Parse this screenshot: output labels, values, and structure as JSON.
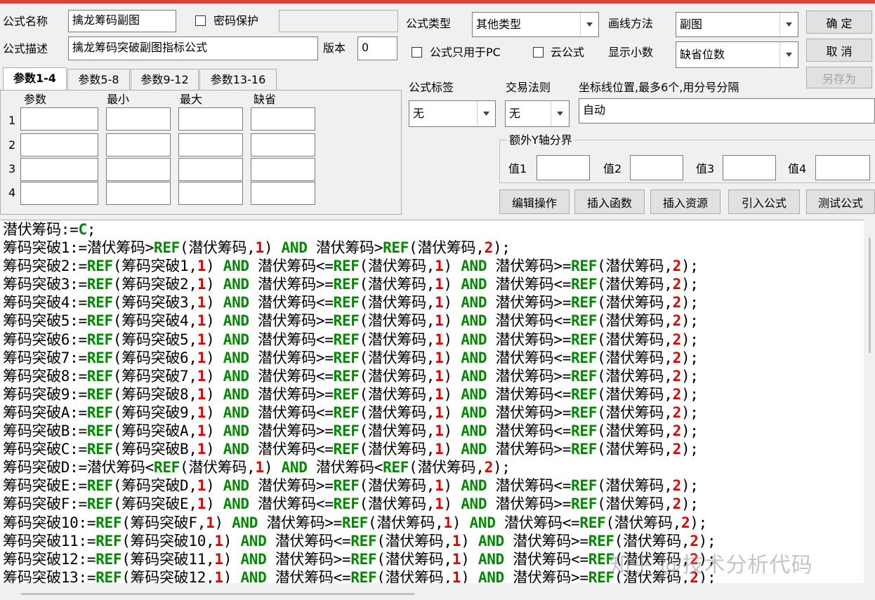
{
  "form": {
    "name_label": "公式名称",
    "name_value": "擒龙筹码副图",
    "password_label": "密码保护",
    "desc_label": "公式描述",
    "desc_value": "擒龙筹码突破副图指标公式",
    "version_label": "版本",
    "version_value": "0",
    "type_label": "公式类型",
    "type_value": "其他类型",
    "draw_label": "画线方法",
    "draw_value": "副图",
    "pc_only_label": "公式只用于PC",
    "cloud_label": "云公式",
    "decimal_label": "显示小数",
    "decimal_value": "缺省位数",
    "tag_label": "公式标签",
    "tag_value": "无",
    "trade_label": "交易法则",
    "trade_value": "无",
    "axis_label": "坐标线位置,最多6个,用分号分隔",
    "axis_value": "自动",
    "extra_y_label": "额外Y轴分界",
    "v1_label": "值1",
    "v2_label": "值2",
    "v3_label": "值3",
    "v4_label": "值4"
  },
  "buttons": {
    "ok": "确 定",
    "cancel": "取 消",
    "save_as": "另存为",
    "edit_ops": "编辑操作",
    "insert_func": "插入函数",
    "insert_res": "插入资源",
    "import_formula": "引入公式",
    "test_formula": "测试公式"
  },
  "tabs": [
    "参数1-4",
    "参数5-8",
    "参数9-12",
    "参数13-16"
  ],
  "param_headers": [
    "参数",
    "最小",
    "最大",
    "缺省"
  ],
  "param_rows": [
    "1",
    "2",
    "3",
    "4"
  ],
  "code_lines": [
    [
      [
        "t",
        "潜伏筹码:="
      ],
      [
        "k",
        "C"
      ],
      [
        "t",
        ";"
      ]
    ],
    [
      [
        "t",
        "筹码突破1:=潜伏筹码>"
      ],
      [
        "k",
        "REF"
      ],
      [
        "t",
        "(潜伏筹码,"
      ],
      [
        "n",
        "1"
      ],
      [
        "t",
        ") "
      ],
      [
        "k",
        "AND"
      ],
      [
        "t",
        " 潜伏筹码>"
      ],
      [
        "k",
        "REF"
      ],
      [
        "t",
        "(潜伏筹码,"
      ],
      [
        "n",
        "2"
      ],
      [
        "t",
        ");"
      ]
    ],
    [
      [
        "t",
        "筹码突破2:="
      ],
      [
        "k",
        "REF"
      ],
      [
        "t",
        "(筹码突破1,"
      ],
      [
        "n",
        "1"
      ],
      [
        "t",
        ") "
      ],
      [
        "k",
        "AND"
      ],
      [
        "t",
        " 潜伏筹码<="
      ],
      [
        "k",
        "REF"
      ],
      [
        "t",
        "(潜伏筹码,"
      ],
      [
        "n",
        "1"
      ],
      [
        "t",
        ") "
      ],
      [
        "k",
        "AND"
      ],
      [
        "t",
        " 潜伏筹码>="
      ],
      [
        "k",
        "REF"
      ],
      [
        "t",
        "(潜伏筹码,"
      ],
      [
        "n",
        "2"
      ],
      [
        "t",
        ");"
      ]
    ],
    [
      [
        "t",
        "筹码突破3:="
      ],
      [
        "k",
        "REF"
      ],
      [
        "t",
        "(筹码突破2,"
      ],
      [
        "n",
        "1"
      ],
      [
        "t",
        ") "
      ],
      [
        "k",
        "AND"
      ],
      [
        "t",
        " 潜伏筹码>="
      ],
      [
        "k",
        "REF"
      ],
      [
        "t",
        "(潜伏筹码,"
      ],
      [
        "n",
        "1"
      ],
      [
        "t",
        ") "
      ],
      [
        "k",
        "AND"
      ],
      [
        "t",
        " 潜伏筹码<="
      ],
      [
        "k",
        "REF"
      ],
      [
        "t",
        "(潜伏筹码,"
      ],
      [
        "n",
        "2"
      ],
      [
        "t",
        ");"
      ]
    ],
    [
      [
        "t",
        "筹码突破4:="
      ],
      [
        "k",
        "REF"
      ],
      [
        "t",
        "(筹码突破3,"
      ],
      [
        "n",
        "1"
      ],
      [
        "t",
        ") "
      ],
      [
        "k",
        "AND"
      ],
      [
        "t",
        " 潜伏筹码<="
      ],
      [
        "k",
        "REF"
      ],
      [
        "t",
        "(潜伏筹码,"
      ],
      [
        "n",
        "1"
      ],
      [
        "t",
        ") "
      ],
      [
        "k",
        "AND"
      ],
      [
        "t",
        " 潜伏筹码>="
      ],
      [
        "k",
        "REF"
      ],
      [
        "t",
        "(潜伏筹码,"
      ],
      [
        "n",
        "2"
      ],
      [
        "t",
        ");"
      ]
    ],
    [
      [
        "t",
        "筹码突破5:="
      ],
      [
        "k",
        "REF"
      ],
      [
        "t",
        "(筹码突破4,"
      ],
      [
        "n",
        "1"
      ],
      [
        "t",
        ") "
      ],
      [
        "k",
        "AND"
      ],
      [
        "t",
        " 潜伏筹码>="
      ],
      [
        "k",
        "REF"
      ],
      [
        "t",
        "(潜伏筹码,"
      ],
      [
        "n",
        "1"
      ],
      [
        "t",
        ") "
      ],
      [
        "k",
        "AND"
      ],
      [
        "t",
        " 潜伏筹码<="
      ],
      [
        "k",
        "REF"
      ],
      [
        "t",
        "(潜伏筹码,"
      ],
      [
        "n",
        "2"
      ],
      [
        "t",
        ");"
      ]
    ],
    [
      [
        "t",
        "筹码突破6:="
      ],
      [
        "k",
        "REF"
      ],
      [
        "t",
        "(筹码突破5,"
      ],
      [
        "n",
        "1"
      ],
      [
        "t",
        ") "
      ],
      [
        "k",
        "AND"
      ],
      [
        "t",
        " 潜伏筹码<="
      ],
      [
        "k",
        "REF"
      ],
      [
        "t",
        "(潜伏筹码,"
      ],
      [
        "n",
        "1"
      ],
      [
        "t",
        ") "
      ],
      [
        "k",
        "AND"
      ],
      [
        "t",
        " 潜伏筹码>="
      ],
      [
        "k",
        "REF"
      ],
      [
        "t",
        "(潜伏筹码,"
      ],
      [
        "n",
        "2"
      ],
      [
        "t",
        ");"
      ]
    ],
    [
      [
        "t",
        "筹码突破7:="
      ],
      [
        "k",
        "REF"
      ],
      [
        "t",
        "(筹码突破6,"
      ],
      [
        "n",
        "1"
      ],
      [
        "t",
        ") "
      ],
      [
        "k",
        "AND"
      ],
      [
        "t",
        " 潜伏筹码>="
      ],
      [
        "k",
        "REF"
      ],
      [
        "t",
        "(潜伏筹码,"
      ],
      [
        "n",
        "1"
      ],
      [
        "t",
        ") "
      ],
      [
        "k",
        "AND"
      ],
      [
        "t",
        " 潜伏筹码<="
      ],
      [
        "k",
        "REF"
      ],
      [
        "t",
        "(潜伏筹码,"
      ],
      [
        "n",
        "2"
      ],
      [
        "t",
        ");"
      ]
    ],
    [
      [
        "t",
        "筹码突破8:="
      ],
      [
        "k",
        "REF"
      ],
      [
        "t",
        "(筹码突破7,"
      ],
      [
        "n",
        "1"
      ],
      [
        "t",
        ") "
      ],
      [
        "k",
        "AND"
      ],
      [
        "t",
        " 潜伏筹码<="
      ],
      [
        "k",
        "REF"
      ],
      [
        "t",
        "(潜伏筹码,"
      ],
      [
        "n",
        "1"
      ],
      [
        "t",
        ") "
      ],
      [
        "k",
        "AND"
      ],
      [
        "t",
        " 潜伏筹码>="
      ],
      [
        "k",
        "REF"
      ],
      [
        "t",
        "(潜伏筹码,"
      ],
      [
        "n",
        "2"
      ],
      [
        "t",
        ");"
      ]
    ],
    [
      [
        "t",
        "筹码突破9:="
      ],
      [
        "k",
        "REF"
      ],
      [
        "t",
        "(筹码突破8,"
      ],
      [
        "n",
        "1"
      ],
      [
        "t",
        ") "
      ],
      [
        "k",
        "AND"
      ],
      [
        "t",
        " 潜伏筹码>="
      ],
      [
        "k",
        "REF"
      ],
      [
        "t",
        "(潜伏筹码,"
      ],
      [
        "n",
        "1"
      ],
      [
        "t",
        ") "
      ],
      [
        "k",
        "AND"
      ],
      [
        "t",
        " 潜伏筹码<="
      ],
      [
        "k",
        "REF"
      ],
      [
        "t",
        "(潜伏筹码,"
      ],
      [
        "n",
        "2"
      ],
      [
        "t",
        ");"
      ]
    ],
    [
      [
        "t",
        "筹码突破A:="
      ],
      [
        "k",
        "REF"
      ],
      [
        "t",
        "(筹码突破9,"
      ],
      [
        "n",
        "1"
      ],
      [
        "t",
        ") "
      ],
      [
        "k",
        "AND"
      ],
      [
        "t",
        " 潜伏筹码<="
      ],
      [
        "k",
        "REF"
      ],
      [
        "t",
        "(潜伏筹码,"
      ],
      [
        "n",
        "1"
      ],
      [
        "t",
        ") "
      ],
      [
        "k",
        "AND"
      ],
      [
        "t",
        " 潜伏筹码>="
      ],
      [
        "k",
        "REF"
      ],
      [
        "t",
        "(潜伏筹码,"
      ],
      [
        "n",
        "2"
      ],
      [
        "t",
        ");"
      ]
    ],
    [
      [
        "t",
        "筹码突破B:="
      ],
      [
        "k",
        "REF"
      ],
      [
        "t",
        "(筹码突破A,"
      ],
      [
        "n",
        "1"
      ],
      [
        "t",
        ") "
      ],
      [
        "k",
        "AND"
      ],
      [
        "t",
        " 潜伏筹码>="
      ],
      [
        "k",
        "REF"
      ],
      [
        "t",
        "(潜伏筹码,"
      ],
      [
        "n",
        "1"
      ],
      [
        "t",
        ") "
      ],
      [
        "k",
        "AND"
      ],
      [
        "t",
        " 潜伏筹码<="
      ],
      [
        "k",
        "REF"
      ],
      [
        "t",
        "(潜伏筹码,"
      ],
      [
        "n",
        "2"
      ],
      [
        "t",
        ");"
      ]
    ],
    [
      [
        "t",
        "筹码突破C:="
      ],
      [
        "k",
        "REF"
      ],
      [
        "t",
        "(筹码突破B,"
      ],
      [
        "n",
        "1"
      ],
      [
        "t",
        ") "
      ],
      [
        "k",
        "AND"
      ],
      [
        "t",
        " 潜伏筹码<="
      ],
      [
        "k",
        "REF"
      ],
      [
        "t",
        "(潜伏筹码,"
      ],
      [
        "n",
        "1"
      ],
      [
        "t",
        ") "
      ],
      [
        "k",
        "AND"
      ],
      [
        "t",
        " 潜伏筹码>="
      ],
      [
        "k",
        "REF"
      ],
      [
        "t",
        "(潜伏筹码,"
      ],
      [
        "n",
        "2"
      ],
      [
        "t",
        ");"
      ]
    ],
    [
      [
        "t",
        "筹码突破D:=潜伏筹码<"
      ],
      [
        "k",
        "REF"
      ],
      [
        "t",
        "(潜伏筹码,"
      ],
      [
        "n",
        "1"
      ],
      [
        "t",
        ") "
      ],
      [
        "k",
        "AND"
      ],
      [
        "t",
        " 潜伏筹码<"
      ],
      [
        "k",
        "REF"
      ],
      [
        "t",
        "(潜伏筹码,"
      ],
      [
        "n",
        "2"
      ],
      [
        "t",
        ");"
      ]
    ],
    [
      [
        "t",
        "筹码突破E:="
      ],
      [
        "k",
        "REF"
      ],
      [
        "t",
        "(筹码突破D,"
      ],
      [
        "n",
        "1"
      ],
      [
        "t",
        ") "
      ],
      [
        "k",
        "AND"
      ],
      [
        "t",
        " 潜伏筹码>="
      ],
      [
        "k",
        "REF"
      ],
      [
        "t",
        "(潜伏筹码,"
      ],
      [
        "n",
        "1"
      ],
      [
        "t",
        ") "
      ],
      [
        "k",
        "AND"
      ],
      [
        "t",
        " 潜伏筹码<="
      ],
      [
        "k",
        "REF"
      ],
      [
        "t",
        "(潜伏筹码,"
      ],
      [
        "n",
        "2"
      ],
      [
        "t",
        ");"
      ]
    ],
    [
      [
        "t",
        "筹码突破F:="
      ],
      [
        "k",
        "REF"
      ],
      [
        "t",
        "(筹码突破E,"
      ],
      [
        "n",
        "1"
      ],
      [
        "t",
        ") "
      ],
      [
        "k",
        "AND"
      ],
      [
        "t",
        " 潜伏筹码<="
      ],
      [
        "k",
        "REF"
      ],
      [
        "t",
        "(潜伏筹码,"
      ],
      [
        "n",
        "1"
      ],
      [
        "t",
        ") "
      ],
      [
        "k",
        "AND"
      ],
      [
        "t",
        " 潜伏筹码>="
      ],
      [
        "k",
        "REF"
      ],
      [
        "t",
        "(潜伏筹码,"
      ],
      [
        "n",
        "2"
      ],
      [
        "t",
        ");"
      ]
    ],
    [
      [
        "t",
        "筹码突破10:="
      ],
      [
        "k",
        "REF"
      ],
      [
        "t",
        "(筹码突破F,"
      ],
      [
        "n",
        "1"
      ],
      [
        "t",
        ") "
      ],
      [
        "k",
        "AND"
      ],
      [
        "t",
        " 潜伏筹码>="
      ],
      [
        "k",
        "REF"
      ],
      [
        "t",
        "(潜伏筹码,"
      ],
      [
        "n",
        "1"
      ],
      [
        "t",
        ") "
      ],
      [
        "k",
        "AND"
      ],
      [
        "t",
        " 潜伏筹码<="
      ],
      [
        "k",
        "REF"
      ],
      [
        "t",
        "(潜伏筹码,"
      ],
      [
        "n",
        "2"
      ],
      [
        "t",
        ");"
      ]
    ],
    [
      [
        "t",
        "筹码突破11:="
      ],
      [
        "k",
        "REF"
      ],
      [
        "t",
        "(筹码突破10,"
      ],
      [
        "n",
        "1"
      ],
      [
        "t",
        ") "
      ],
      [
        "k",
        "AND"
      ],
      [
        "t",
        " 潜伏筹码<="
      ],
      [
        "k",
        "REF"
      ],
      [
        "t",
        "(潜伏筹码,"
      ],
      [
        "n",
        "1"
      ],
      [
        "t",
        ") "
      ],
      [
        "k",
        "AND"
      ],
      [
        "t",
        " 潜伏筹码>="
      ],
      [
        "k",
        "REF"
      ],
      [
        "t",
        "(潜伏筹码,"
      ],
      [
        "n",
        "2"
      ],
      [
        "t",
        ");"
      ]
    ],
    [
      [
        "t",
        "筹码突破12:="
      ],
      [
        "k",
        "REF"
      ],
      [
        "t",
        "(筹码突破11,"
      ],
      [
        "n",
        "1"
      ],
      [
        "t",
        ") "
      ],
      [
        "k",
        "AND"
      ],
      [
        "t",
        " 潜伏筹码>="
      ],
      [
        "k",
        "REF"
      ],
      [
        "t",
        "(潜伏筹码,"
      ],
      [
        "n",
        "1"
      ],
      [
        "t",
        ") "
      ],
      [
        "k",
        "AND"
      ],
      [
        "t",
        " 潜伏筹码<="
      ],
      [
        "k",
        "REF"
      ],
      [
        "t",
        "(潜伏筹码,"
      ],
      [
        "n",
        "2"
      ],
      [
        "t",
        ");"
      ]
    ],
    [
      [
        "t",
        "筹码突破13:="
      ],
      [
        "k",
        "REF"
      ],
      [
        "t",
        "(筹码突破12,"
      ],
      [
        "n",
        "1"
      ],
      [
        "t",
        ") "
      ],
      [
        "k",
        "AND"
      ],
      [
        "t",
        " 潜伏筹码<="
      ],
      [
        "k",
        "REF"
      ],
      [
        "t",
        "(潜伏筹码,"
      ],
      [
        "n",
        "1"
      ],
      [
        "t",
        ") "
      ],
      [
        "k",
        "AND"
      ],
      [
        "t",
        " 潜伏筹码>="
      ],
      [
        "k",
        "REF"
      ],
      [
        "t",
        "(潜伏筹码,"
      ],
      [
        "n",
        "2"
      ],
      [
        "t",
        ");"
      ]
    ]
  ],
  "watermark": "知乎 @技术分析代码",
  "colors": {
    "keyword": "#008a00",
    "number": "#e30000",
    "title_bar": "#d9423a"
  }
}
